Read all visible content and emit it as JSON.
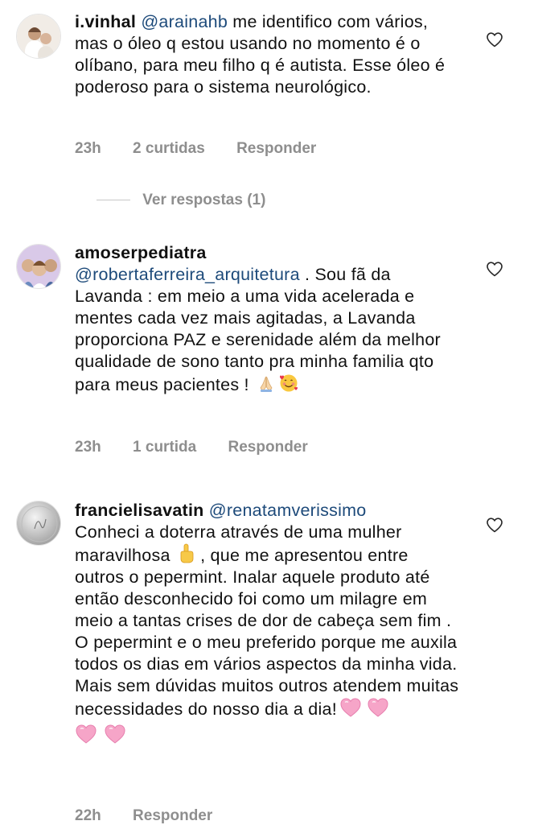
{
  "comments": [
    {
      "username": "i.vinhal",
      "mention": "@arainahb",
      "text": " me identifico com vários, mas o óleo q estou usando no momento é o olíbano, para meu filho q é autista. Esse óleo é poderoso para o sistema neurológico.",
      "time": "23h",
      "likes": "2 curtidas",
      "reply": "Responder",
      "view_replies": "Ver respostas (1)"
    },
    {
      "username": "amoserpediatra",
      "mention": "@robertaferreira_arquitetura",
      "text": " . Sou fã da Lavanda : em meio a uma vida acelerada e mentes cada vez mais agitadas,  a Lavanda proporciona PAZ e serenidade além da melhor qualidade de sono tanto pra minha familia qto para meus pacientes ! ",
      "emojis": [
        "folded-hands",
        "smiling-face-with-hearts"
      ],
      "time": "23h",
      "likes": "1 curtida",
      "reply": "Responder"
    },
    {
      "username": "francielisavatin",
      "mention": "@renatamverissimo",
      "text_a": "Conheci a doterra através de uma mulher maravilhosa ",
      "text_b": " , que me apresentou entre outros o pepermint. Inalar aquele produto até então desconhecido foi como um milagre em meio a tantas crises de dor de cabeça sem fim . O pepermint e o meu preferido porque me auxila todos os dias em vários aspectos da minha vida. Mais sem dúvidas muitos outros atendem muitas necessidades do nosso dia a dia!",
      "emojis": [
        "pointing-up",
        "pink-heart",
        "pink-heart",
        "pink-heart",
        "pink-heart"
      ],
      "time": "22h",
      "reply": "Responder"
    }
  ],
  "colors": {
    "mention": "#1d4a7a",
    "meta": "#8e8e8e",
    "heart_pink": "#f6a5c8"
  }
}
